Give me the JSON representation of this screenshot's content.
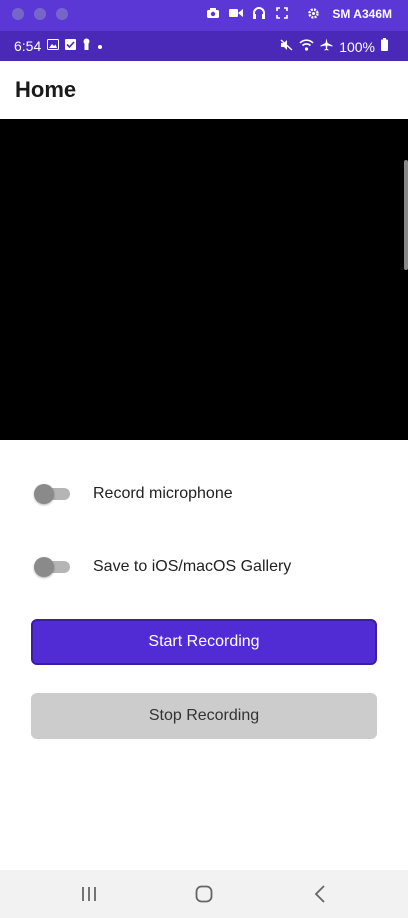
{
  "mirror_bar": {
    "device_name": "SM A346M",
    "tool_icons": [
      "camera-icon",
      "video-icon",
      "headphones-icon",
      "fullscreen-icon",
      "settings-icon"
    ]
  },
  "status_bar": {
    "time": "6:54",
    "battery": "100%"
  },
  "toolbar": {
    "title": "Home"
  },
  "settings": {
    "record_microphone": {
      "label": "Record microphone",
      "on": false
    },
    "save_gallery": {
      "label": "Save to iOS/macOS Gallery",
      "on": false
    }
  },
  "buttons": {
    "start": "Start Recording",
    "stop": "Stop Recording"
  },
  "colors": {
    "accent": "#512bd4",
    "status_bar": "#4a28b8",
    "disabled_button": "#cccccc"
  }
}
